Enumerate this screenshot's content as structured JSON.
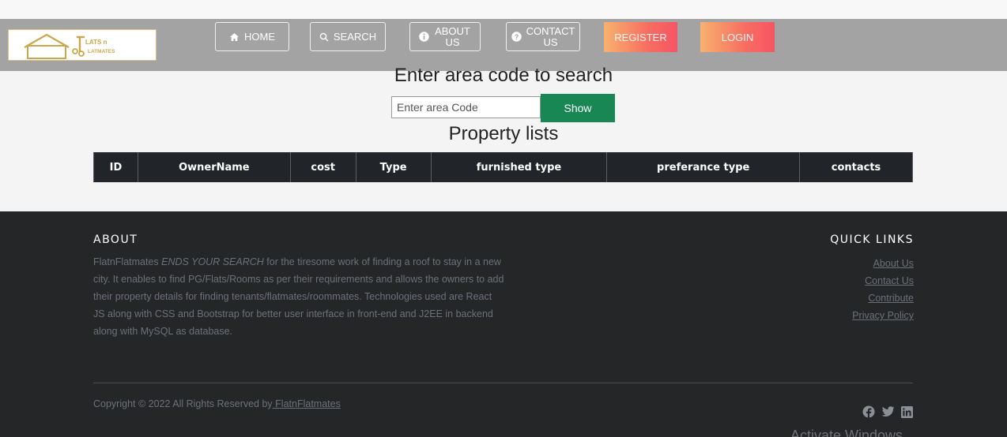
{
  "nav": {
    "logo_text_top": "LATS n",
    "logo_text_bottom": "LATMATES",
    "home_label": "HOME",
    "search_label": "SEARCH",
    "about_label": "ABOUT US",
    "contact_label": "CONTACT US",
    "register_label": "REGISTER",
    "login_label": "LOGIN",
    "icons": {
      "home": "home-icon",
      "search": "search-icon",
      "about": "info-circle-icon",
      "contact": "question-circle-icon"
    }
  },
  "search": {
    "title": "Enter area code to search",
    "placeholder": "Enter area Code",
    "show_label": "Show"
  },
  "property_list": {
    "title": "Property lists",
    "columns": [
      "ID",
      "OwnerName",
      "cost",
      "Type",
      "furnished type",
      "preferance type",
      "contacts"
    ]
  },
  "footer": {
    "about_heading": "ABOUT",
    "about_brand": "FlatnFlatmates ",
    "about_emph": "ENDS YOUR SEARCH",
    "about_rest": " for the tiresome work of finding a roof to stay in a new city. It enables to find PG/Flats/Rooms as per their requirements and allows the owners to add their property details for finding tenants/flatmates/roommates. Technologies used are React JS along with CSS and Bootstrap for better user interface in front-end and J2EE in backend along with MySQL as database.",
    "quick_links_heading": "QUICK LINKS",
    "quick_links": [
      "About Us",
      "Contact Us",
      "Contribute",
      "Privacy Policy"
    ],
    "copyright_text": "Copyright © 2022 All Rights Reserved by",
    "copyright_link": " FlatnFlatmates",
    "social_icons": [
      "facebook-icon",
      "twitter-icon",
      "linkedin-icon"
    ],
    "watermark": "Activate Windows"
  },
  "colors": {
    "navbar": "#a3a3a3",
    "show_button": "#198754",
    "table_header": "#212529",
    "footer": "#252628",
    "gradient_start": "#ffb36b",
    "gradient_end": "#ff4e5e"
  }
}
